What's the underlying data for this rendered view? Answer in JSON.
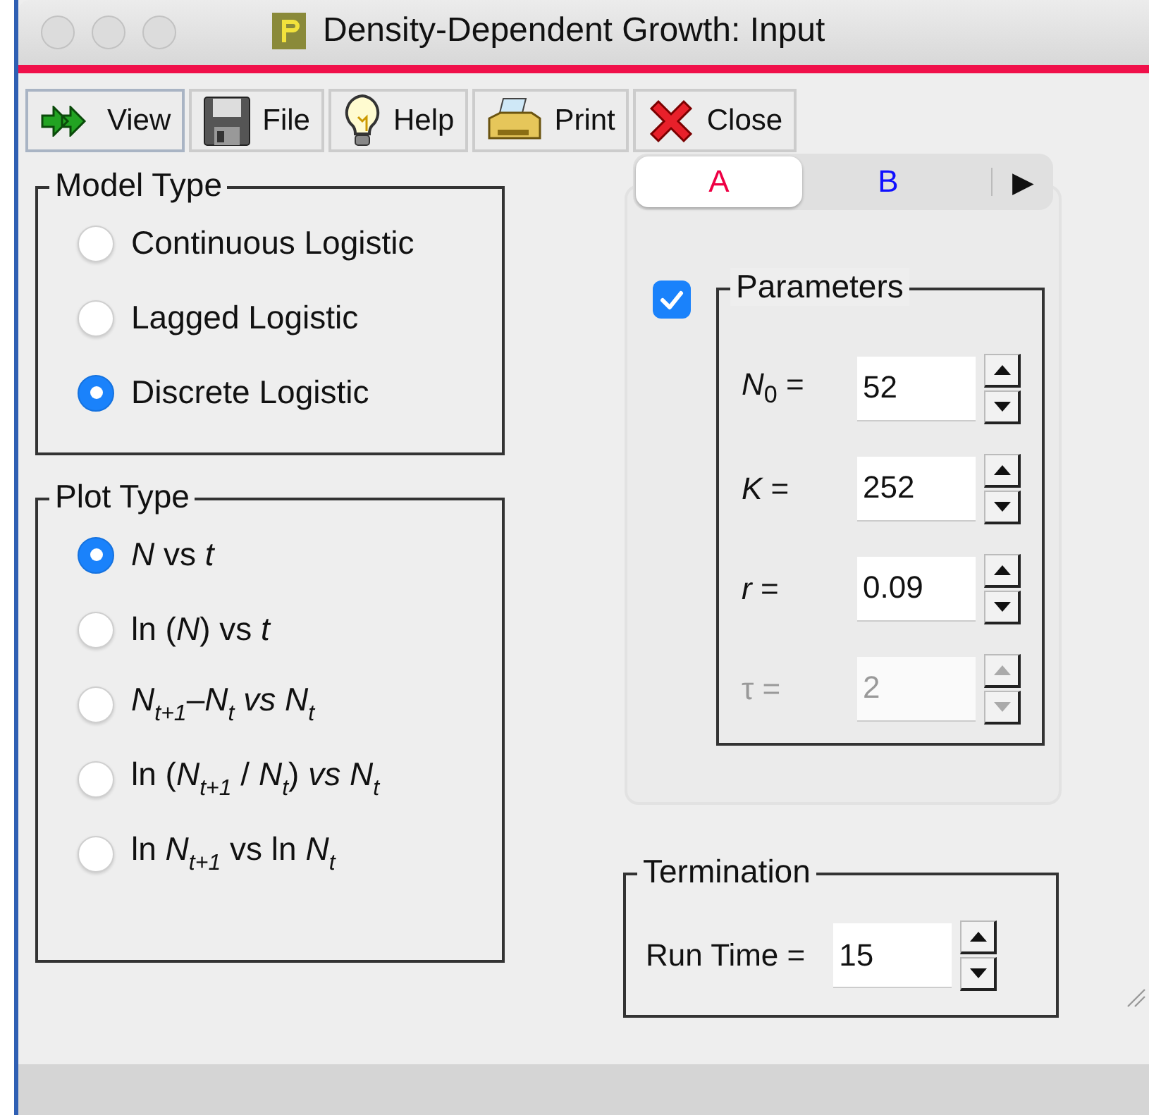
{
  "window": {
    "title": "Density-Dependent Growth: Input"
  },
  "toolbar": [
    {
      "label": "View"
    },
    {
      "label": "File"
    },
    {
      "label": "Help"
    },
    {
      "label": "Print"
    },
    {
      "label": "Close"
    }
  ],
  "model_type": {
    "title": "Model Type",
    "options": [
      {
        "label": "Continuous Logistic",
        "selected": false
      },
      {
        "label": "Lagged Logistic",
        "selected": false
      },
      {
        "label": "Discrete Logistic",
        "selected": true
      }
    ]
  },
  "plot_type": {
    "title": "Plot Type",
    "options": [
      {
        "label": "*N* vs *t*",
        "selected": true
      },
      {
        "label": "ln (*N*) vs *t*",
        "selected": false
      },
      {
        "label": "*N*$_{t+1}$–*N*$_{t}$ *vs N*$_{t}$",
        "selected": false
      },
      {
        "label": "ln (*N*$_{t+1}$ / *N*$_{t}$) *vs N*$_{t}$",
        "selected": false
      },
      {
        "label": "ln *N*$_{t+1}$ vs ln *N*$_{t}$",
        "selected": false
      }
    ]
  },
  "tabs": [
    {
      "label": "A",
      "selected": true,
      "color": "#ee0044"
    },
    {
      "label": "B",
      "selected": false,
      "color": "#1010ff"
    }
  ],
  "tab_scroll": "▶",
  "parameters": {
    "checked": true,
    "title": "Parameters",
    "fields": [
      {
        "label": "*N*$_{0}$ =",
        "value": "52",
        "disabled": false
      },
      {
        "label": "*K* =",
        "value": "252",
        "disabled": false
      },
      {
        "label": "*r* =",
        "value": "0.09",
        "disabled": false
      },
      {
        "label": "τ =",
        "value": "2",
        "disabled": true
      }
    ]
  },
  "termination": {
    "title": "Termination",
    "label": "Run Time =",
    "value": "15"
  }
}
